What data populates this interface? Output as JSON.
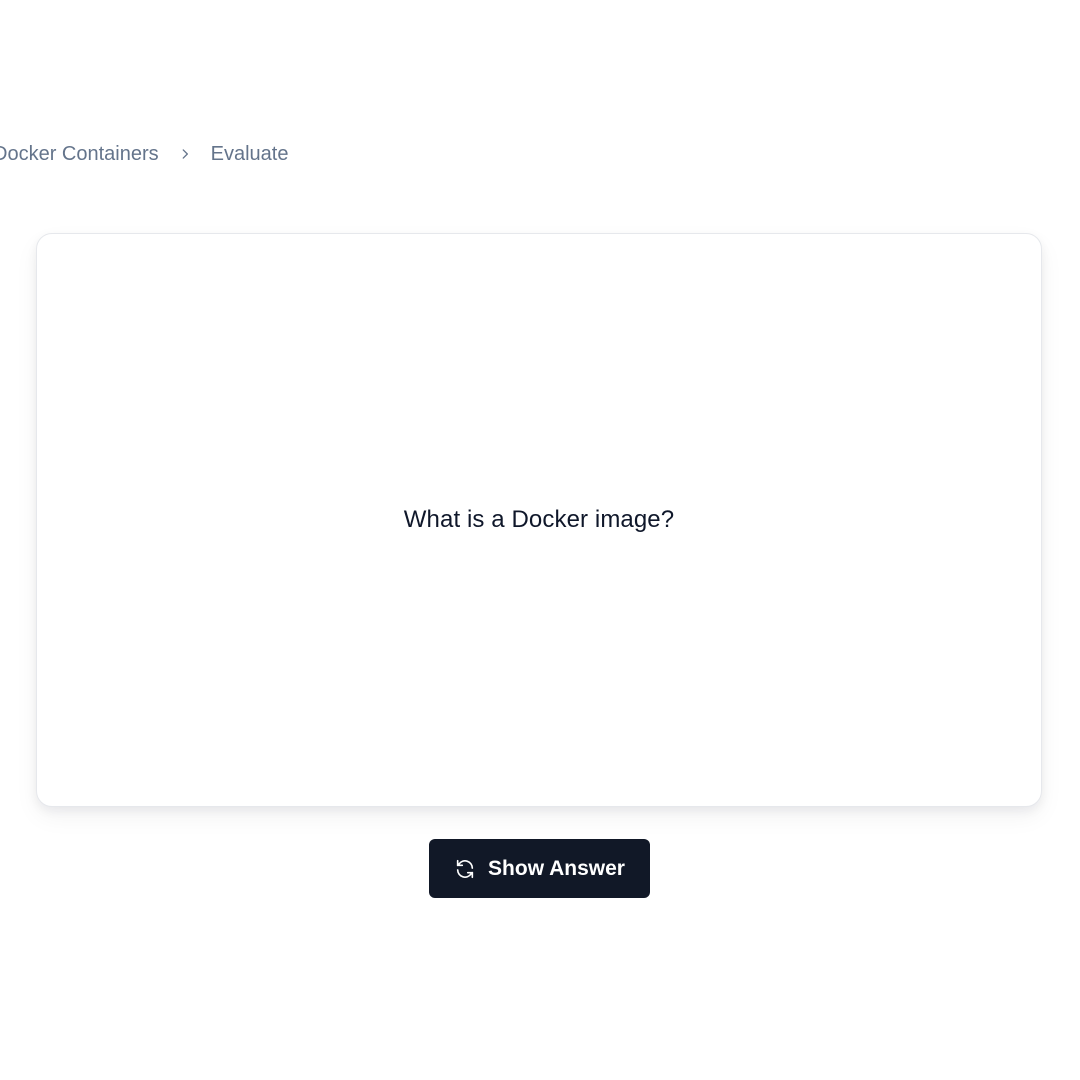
{
  "breadcrumb": {
    "items": [
      {
        "label": "Docker Containers"
      },
      {
        "label": "Evaluate"
      }
    ],
    "separator_icon": "chevron-right-icon"
  },
  "flashcard": {
    "question": "What is a Docker image?"
  },
  "actions": {
    "show_answer_label": "Show Answer",
    "show_answer_icon": "refresh-icon"
  },
  "colors": {
    "button_bg": "#111827",
    "button_text": "#ffffff",
    "breadcrumb_text": "#64748b",
    "card_border": "#e6e8ec",
    "question_text": "#0f172a"
  }
}
